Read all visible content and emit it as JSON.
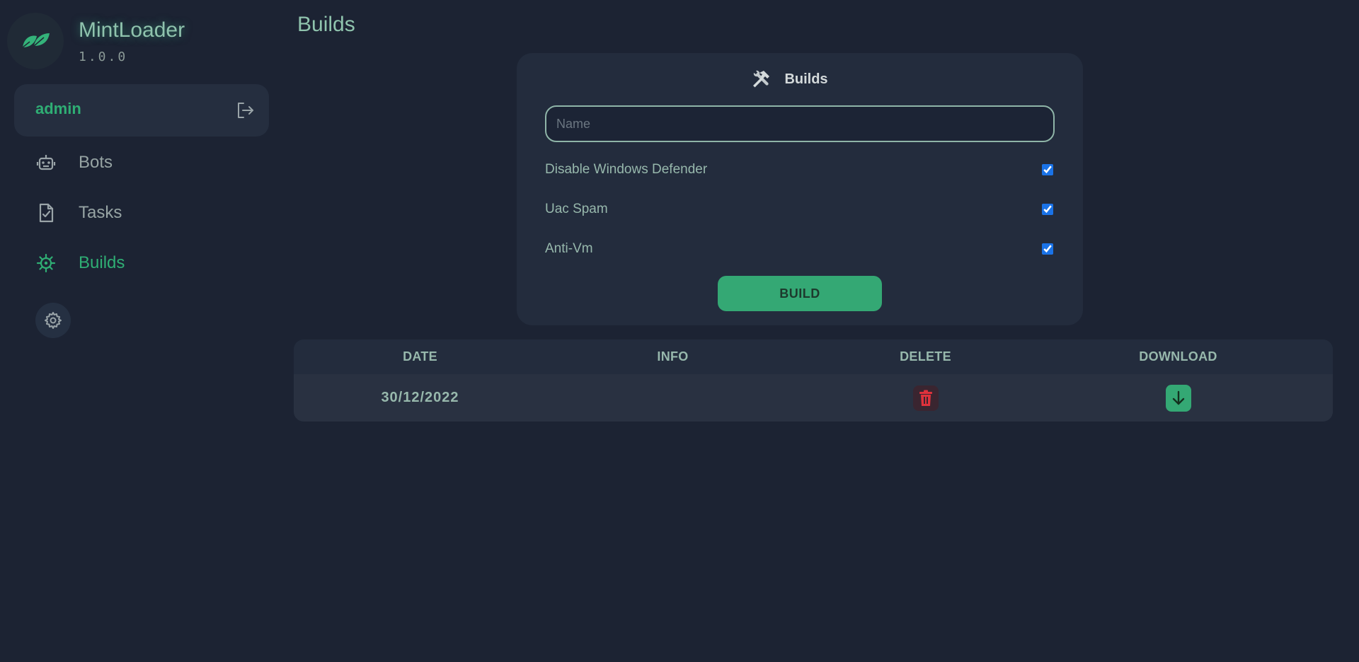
{
  "brand": {
    "name": "MintLoader",
    "version": "1.0.0",
    "logo_icon": "leaf-icon"
  },
  "user": {
    "name": "admin",
    "logout_icon": "logout-icon"
  },
  "nav": {
    "items": [
      {
        "label": "Bots",
        "icon": "robot-icon",
        "active": false
      },
      {
        "label": "Tasks",
        "icon": "file-check-icon",
        "active": false
      },
      {
        "label": "Builds",
        "icon": "virus-icon",
        "active": true
      }
    ],
    "settings_icon": "gear-icon"
  },
  "page": {
    "title": "Builds"
  },
  "builder": {
    "title": "Builds",
    "icon": "hammer-wrench-icon",
    "name_placeholder": "Name",
    "name_value": "",
    "options": [
      {
        "label": "Disable Windows Defender",
        "checked": true
      },
      {
        "label": "Uac Spam",
        "checked": true
      },
      {
        "label": "Anti-Vm",
        "checked": true
      }
    ],
    "build_label": "BUILD"
  },
  "table": {
    "headers": [
      "DATE",
      "INFO",
      "DELETE",
      "DOWNLOAD"
    ],
    "rows": [
      {
        "date": "30/12/2022",
        "info": "",
        "delete_icon": "trash-icon",
        "download_icon": "arrow-down-icon"
      }
    ]
  },
  "colors": {
    "background": "#1c2333",
    "card": "#232c3d",
    "accent": "#34a874",
    "accent_text": "#2fae74",
    "danger": "#e0323c"
  }
}
